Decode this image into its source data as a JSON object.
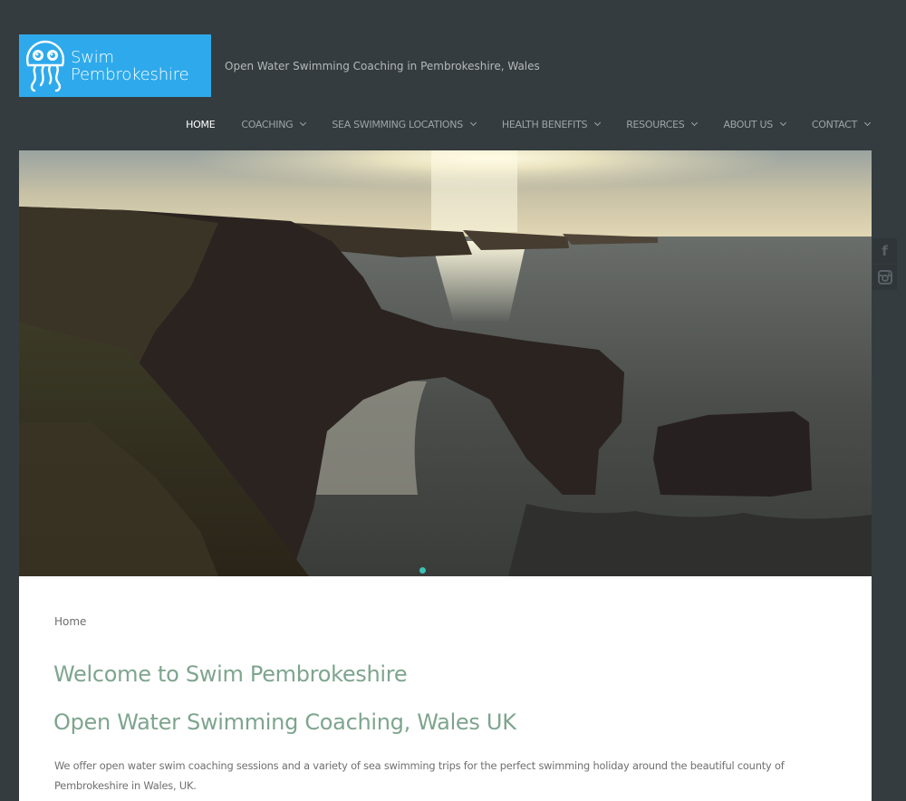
{
  "header": {
    "logo": {
      "line1": "Swim",
      "line2": "Pembrokeshire",
      "icon": "jellyfish-icon",
      "bg_color": "#2eaaec"
    },
    "tagline": "Open Water Swimming Coaching in Pembrokeshire, Wales"
  },
  "nav": {
    "items": [
      {
        "label": "HOME",
        "active": true,
        "has_dropdown": false
      },
      {
        "label": "COACHING",
        "active": false,
        "has_dropdown": true
      },
      {
        "label": "SEA SWIMMING LOCATIONS",
        "active": false,
        "has_dropdown": true
      },
      {
        "label": "HEALTH BENEFITS",
        "active": false,
        "has_dropdown": true
      },
      {
        "label": "RESOURCES",
        "active": false,
        "has_dropdown": true
      },
      {
        "label": "ABOUT US",
        "active": false,
        "has_dropdown": true
      },
      {
        "label": "CONTACT",
        "active": false,
        "has_dropdown": true
      }
    ]
  },
  "hero": {
    "description": "Sunset over sea arch on Pembrokeshire coastline",
    "slider_active_index": 0,
    "slider_dot_color": "#39c3b6"
  },
  "social": {
    "facebook": {
      "glyph": "f",
      "icon": "facebook-icon"
    },
    "instagram": {
      "glyph": "◘",
      "icon": "instagram-icon"
    }
  },
  "content": {
    "breadcrumb": "Home",
    "title": "Welcome to Swim Pembrokeshire",
    "subtitle": "Open Water Swimming Coaching, Wales UK",
    "intro": "We offer open water swim coaching sessions and a variety of sea swimming trips for the perfect swimming holiday around the beautiful county of Pembrokeshire in Wales, UK.",
    "heading_color": "#7ea58e"
  }
}
